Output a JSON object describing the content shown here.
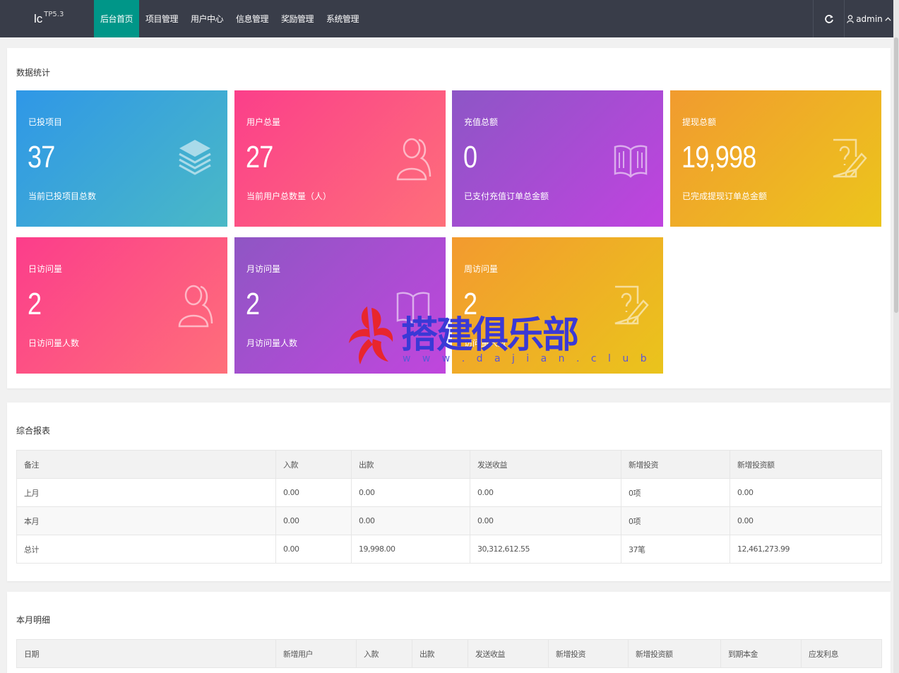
{
  "header": {
    "logo_text": "lc",
    "logo_version": "TP5.3",
    "nav": [
      "后台首页",
      "项目管理",
      "用户中心",
      "信息管理",
      "奖励管理",
      "系统管理"
    ],
    "refresh_glyph": "↻",
    "user_name": "admin",
    "user_caret": "^"
  },
  "stats": {
    "title": "数据统计",
    "cards": [
      {
        "label": "已投项目",
        "value": "37",
        "desc": "当前已投项目总数",
        "icon": "layers-icon"
      },
      {
        "label": "用户总量",
        "value": "27",
        "desc": "当前用户总数量（人）",
        "icon": "user-icon"
      },
      {
        "label": "充值总额",
        "value": "0",
        "desc": "已支付充值订单总金额",
        "icon": "book-icon"
      },
      {
        "label": "提现总额",
        "value": "19,998",
        "desc": "已完成提现订单总金额",
        "icon": "help-doc-icon"
      },
      {
        "label": "日访问量",
        "value": "2",
        "desc": "日访问量人数",
        "icon": "user-icon"
      },
      {
        "label": "月访问量",
        "value": "2",
        "desc": "月访问量人数",
        "icon": "book-icon"
      },
      {
        "label": "周访问量",
        "value": "2",
        "desc": "访问量人数",
        "icon": "help-doc-icon"
      }
    ]
  },
  "report": {
    "title": "综合报表",
    "columns": [
      "备注",
      "入款",
      "出款",
      "发送收益",
      "新增投资",
      "新增投资额"
    ],
    "rows": [
      [
        "上月",
        "0.00",
        "0.00",
        "0.00",
        "0项",
        "0.00"
      ],
      [
        "本月",
        "0.00",
        "0.00",
        "0.00",
        "0项",
        "0.00"
      ],
      [
        "总计",
        "0.00",
        "19,998.00",
        "30,312,612.55",
        "37笔",
        "12,461,273.99"
      ]
    ]
  },
  "monthly": {
    "title": "本月明细",
    "columns": [
      "日期",
      "新增用户",
      "入款",
      "出款",
      "发送收益",
      "新增投资",
      "新增投资额",
      "到期本金",
      "应发利息"
    ]
  },
  "watermark": {
    "text": "搭建俱乐部",
    "url": "w w w . d a j i a n . c l u b"
  },
  "colors": {
    "header_bg": "#393d49",
    "active_nav": "#009688",
    "watermark": "#3a39d6",
    "watermark_logo": "#e8262d"
  }
}
